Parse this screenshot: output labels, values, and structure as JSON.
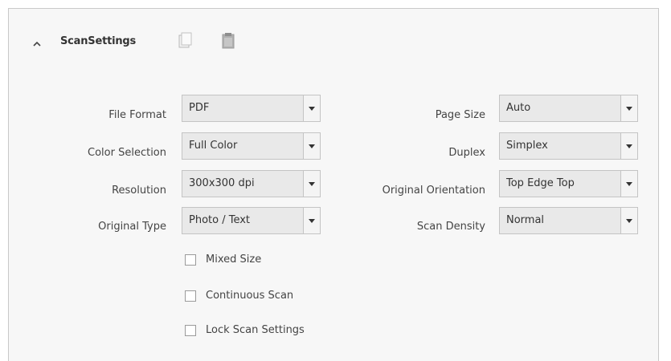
{
  "section": {
    "title": "ScanSettings",
    "collapsed": false
  },
  "header_icons": [
    "copy-icon",
    "paste-icon"
  ],
  "fields_left": [
    {
      "label": "File Format",
      "value": "PDF"
    },
    {
      "label": "Color Selection",
      "value": "Full Color"
    },
    {
      "label": "Resolution",
      "value": "300x300 dpi"
    },
    {
      "label": "Original Type",
      "value": "Photo / Text"
    }
  ],
  "fields_right": [
    {
      "label": "Page Size",
      "value": "Auto"
    },
    {
      "label": "Duplex",
      "value": "Simplex"
    },
    {
      "label": "Original Orientation",
      "value": "Top Edge Top"
    },
    {
      "label": "Scan Density",
      "value": "Normal"
    }
  ],
  "checkboxes": [
    {
      "label": "Mixed Size",
      "checked": false
    },
    {
      "label": "Continuous Scan",
      "checked": false
    },
    {
      "label": "Lock Scan Settings",
      "checked": false
    }
  ],
  "colors": {
    "panel_bg": "#f7f7f7",
    "dropdown_bg": "#e9e9e9",
    "border": "#c4c4c4"
  }
}
